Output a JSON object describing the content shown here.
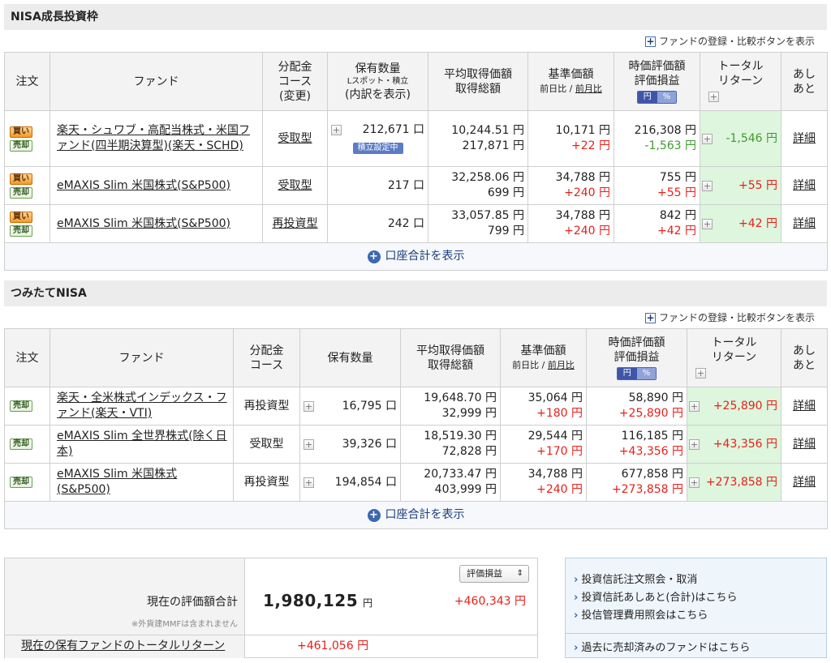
{
  "sections": {
    "nisa_growth": {
      "title": "NISA成長投資枠",
      "fund_compare": "ファンドの登録・比較ボタンを表示"
    },
    "tsumitate": {
      "title": "つみたてNISA",
      "fund_compare": "ファンドの登録・比較ボタンを表示"
    }
  },
  "header1": {
    "order": "注文",
    "fund": "ファンド",
    "course_l1": "分配金",
    "course_l2": "コース",
    "course_l3": "(変更)",
    "qty_l1": "保有数量",
    "qty_sub": "Lスポット・積立",
    "qty_l3": "(内訳を表示)",
    "avg_l1": "平均取得価額",
    "avg_l2": "取得総額",
    "base_l1": "基準価額",
    "base_sub_a": "前日比",
    "base_sub_sep": "/",
    "base_sub_b": "前月比",
    "eval_l1": "時価評価額",
    "eval_l2": "評価損益",
    "toggle_yen": "円",
    "toggle_pct": "%",
    "total_l1": "トータル",
    "total_l2": "リターン",
    "ashi_l1": "あし",
    "ashi_l2": "あと"
  },
  "header2": {
    "order": "注文",
    "fund": "ファンド",
    "course_l1": "分配金",
    "course_l2": "コース",
    "qty_l1": "保有数量",
    "avg_l1": "平均取得価額",
    "avg_l2": "取得総額",
    "base_l1": "基準価額",
    "base_sub_a": "前日比",
    "base_sub_sep": "/",
    "base_sub_b": "前月比",
    "eval_l1": "時価評価額",
    "eval_l2": "評価損益",
    "toggle_yen": "円",
    "toggle_pct": "%",
    "total_l1": "トータル",
    "total_l2": "リターン",
    "ashi_l1": "あし",
    "ashi_l2": "あと"
  },
  "buttons": {
    "buy": "買い",
    "sell": "売却",
    "detail": "詳細",
    "tsumitate_badge": "積立設定中",
    "account_total": "口座合計を表示"
  },
  "growth_rows": [
    {
      "fund": "楽天・シュワブ・高配当株式・米国ファンド(四半期決算型)(楽天・SCHD)",
      "course": "受取型",
      "qty": "212,671 口",
      "avg": "10,244.51 円",
      "total_cost": "217,871 円",
      "base": "10,171 円",
      "base_diff": "+22 円",
      "eval": "216,308 円",
      "eval_pl": "-1,563 円",
      "total_return": "-1,546 円"
    },
    {
      "fund": "eMAXIS Slim 米国株式(S&P500)",
      "course": "受取型",
      "qty": "217 口",
      "avg": "32,258.06 円",
      "total_cost": "699 円",
      "base": "34,788 円",
      "base_diff": "+240 円",
      "eval": "755 円",
      "eval_pl": "+55 円",
      "total_return": "+55 円"
    },
    {
      "fund": "eMAXIS Slim 米国株式(S&P500)",
      "course": "再投資型",
      "qty": "242 口",
      "avg": "33,057.85 円",
      "total_cost": "799 円",
      "base": "34,788 円",
      "base_diff": "+240 円",
      "eval": "842 円",
      "eval_pl": "+42 円",
      "total_return": "+42 円"
    }
  ],
  "tsumitate_rows": [
    {
      "fund": "楽天・全米株式インデックス・ファンド(楽天・VTI)",
      "course": "再投資型",
      "qty": "16,795 口",
      "avg": "19,648.70 円",
      "total_cost": "32,999 円",
      "base": "35,064 円",
      "base_diff": "+180 円",
      "eval": "58,890 円",
      "eval_pl": "+25,890 円",
      "total_return": "+25,890 円"
    },
    {
      "fund": "eMAXIS Slim 全世界株式(除く日本)",
      "course": "受取型",
      "qty": "39,326 口",
      "avg": "18,519.30 円",
      "total_cost": "72,828 円",
      "base": "29,544 円",
      "base_diff": "+170 円",
      "eval": "116,185 円",
      "eval_pl": "+43,356 円",
      "total_return": "+43,356 円"
    },
    {
      "fund": "eMAXIS Slim 米国株式(S&P500)",
      "course": "再投資型",
      "qty": "194,854 口",
      "avg": "20,733.47 円",
      "total_cost": "403,999 円",
      "base": "34,788 円",
      "base_diff": "+240 円",
      "eval": "677,858 円",
      "eval_pl": "+273,858 円",
      "total_return": "+273,858 円"
    }
  ],
  "summary": {
    "label": "現在の評価額合計",
    "note": "※外貨建MMFは含まれません",
    "value": "1,980,125",
    "unit": "円",
    "select": "評価損益",
    "select_arrow": "⇕",
    "gain": "+460,343 円",
    "total_return_label": "現在の保有ファンドのトータルリターン",
    "total_return_value": "+461,056 円"
  },
  "links": {
    "items": [
      "投資信託注文照会・取消",
      "投資信託あしあと(合計)はこちら",
      "投信管理費用照会はこちら"
    ],
    "sold": "過去に売却済みのファンドはこちら"
  },
  "icons": {
    "plus": "+"
  }
}
